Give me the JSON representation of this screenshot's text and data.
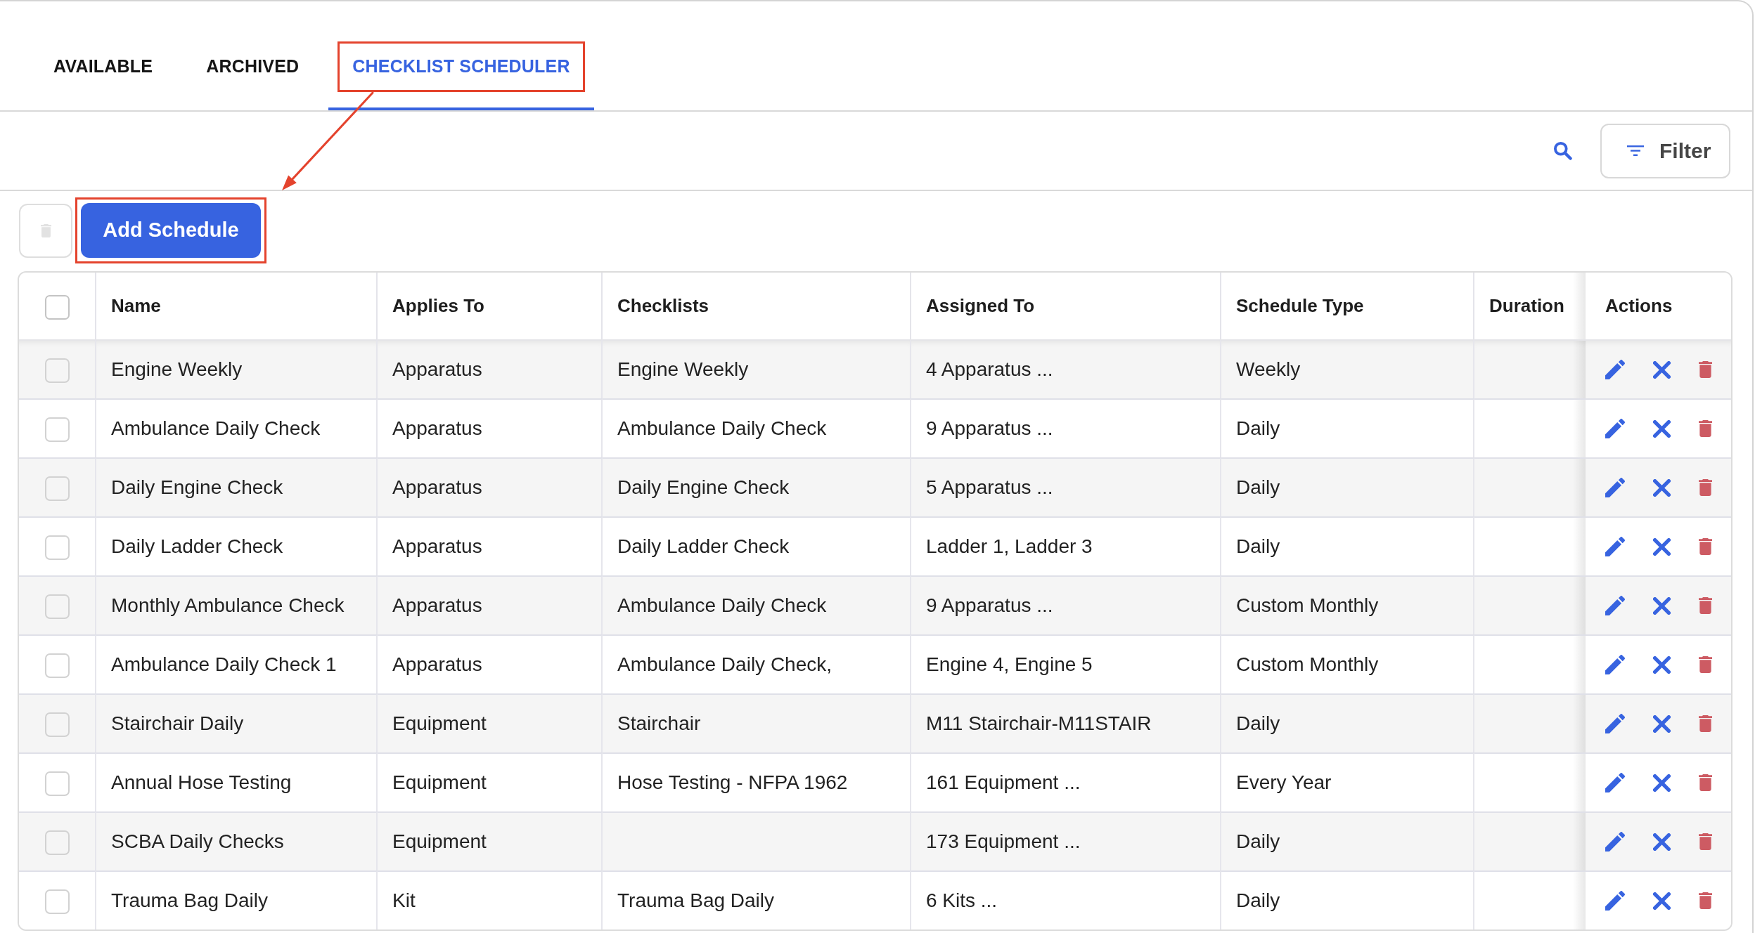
{
  "tabs": [
    {
      "label": "AVAILABLE",
      "selected": false,
      "highlighted": false
    },
    {
      "label": "ARCHIVED",
      "selected": false,
      "highlighted": false
    },
    {
      "label": "CHECKLIST SCHEDULER",
      "selected": true,
      "highlighted": true
    }
  ],
  "filter_button": {
    "label": "Filter"
  },
  "delete_button": {
    "disabled": true
  },
  "add_button": {
    "label": "Add Schedule",
    "highlighted": true
  },
  "callout_arrow": true,
  "table": {
    "select_all_checked": false,
    "columns": [
      "Name",
      "Applies To",
      "Checklists",
      "Assigned To",
      "Schedule Type",
      "Duration",
      "Actions"
    ],
    "rows": [
      {
        "checked": false,
        "name": "Engine Weekly",
        "applies_to": "Apparatus",
        "checklists": "Engine Weekly",
        "assigned_to": "4 Apparatus ...",
        "schedule_type": "Weekly"
      },
      {
        "checked": false,
        "name": "Ambulance Daily Check",
        "applies_to": "Apparatus",
        "checklists": "Ambulance Daily Check",
        "assigned_to": "9 Apparatus ...",
        "schedule_type": "Daily"
      },
      {
        "checked": false,
        "name": "Daily Engine Check",
        "applies_to": "Apparatus",
        "checklists": "Daily Engine Check",
        "assigned_to": "5 Apparatus ...",
        "schedule_type": "Daily"
      },
      {
        "checked": false,
        "name": "Daily Ladder Check",
        "applies_to": "Apparatus",
        "checklists": "Daily Ladder Check",
        "assigned_to": "Ladder 1, Ladder 3",
        "schedule_type": "Daily"
      },
      {
        "checked": false,
        "name": "Monthly Ambulance Check",
        "applies_to": "Apparatus",
        "checklists": "Ambulance Daily Check",
        "assigned_to": "9 Apparatus ...",
        "schedule_type": "Custom Monthly"
      },
      {
        "checked": false,
        "name": "Ambulance Daily Check 1",
        "applies_to": "Apparatus",
        "checklists": "Ambulance Daily Check,",
        "assigned_to": "Engine 4, Engine 5",
        "schedule_type": "Custom Monthly"
      },
      {
        "checked": false,
        "name": "Stairchair Daily",
        "applies_to": "Equipment",
        "checklists": "Stairchair",
        "assigned_to": "M11 Stairchair-M11STAIR",
        "schedule_type": "Daily"
      },
      {
        "checked": false,
        "name": "Annual Hose Testing",
        "applies_to": "Equipment",
        "checklists": "Hose Testing - NFPA 1962",
        "assigned_to": "161 Equipment ...",
        "schedule_type": "Every Year"
      },
      {
        "checked": false,
        "name": "SCBA Daily Checks",
        "applies_to": "Equipment",
        "assigned_to": "173 Equipment ...",
        "schedule_type": "Daily"
      },
      {
        "checked": false,
        "name": "Trauma Bag Daily",
        "applies_to": "Kit",
        "checklists": "Trauma Bag Daily",
        "assigned_to": "6 Kits ...",
        "schedule_type": "Daily"
      }
    ]
  }
}
